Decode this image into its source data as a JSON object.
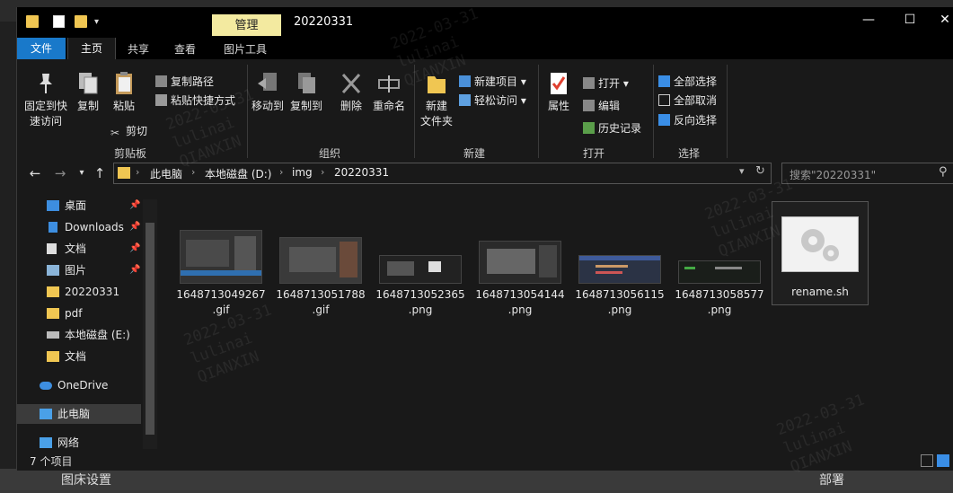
{
  "background": {
    "bottom_label": "图床设置",
    "bottom_right_label": "部署"
  },
  "titlebar": {
    "context_tab": "管理",
    "title": "20220331",
    "minimize": "—",
    "maximize": "☐",
    "close": "✕"
  },
  "ribbon_tabs": {
    "file": "文件",
    "home": "主页",
    "share": "共享",
    "view": "查看",
    "picture_tools": "图片工具"
  },
  "ribbon": {
    "clipboard": {
      "group": "剪贴板",
      "pin_quick_access_line1": "固定到快",
      "pin_quick_access_line2": "速访问",
      "copy": "复制",
      "paste": "粘贴",
      "copy_path": "复制路径",
      "paste_shortcut": "粘贴快捷方式",
      "cut": "剪切"
    },
    "organize": {
      "group": "组织",
      "move_to": "移动到",
      "copy_to": "复制到",
      "delete": "删除",
      "rename": "重命名"
    },
    "new": {
      "group": "新建",
      "new_folder_line1": "新建",
      "new_folder_line2": "文件夹",
      "new_item": "新建项目",
      "easy_access": "轻松访问"
    },
    "open": {
      "group": "打开",
      "properties": "属性",
      "open": "打开",
      "edit": "编辑",
      "history": "历史记录"
    },
    "select": {
      "group": "选择",
      "select_all": "全部选择",
      "select_none": "全部取消",
      "invert": "反向选择"
    }
  },
  "address": {
    "crumbs": [
      "此电脑",
      "本地磁盘 (D:)",
      "img",
      "20220331"
    ],
    "search_placeholder": "搜索\"20220331\""
  },
  "nav_pane": {
    "items": [
      {
        "label": "桌面",
        "pinned": true
      },
      {
        "label": "Downloads",
        "pinned": true
      },
      {
        "label": "文档",
        "pinned": true
      },
      {
        "label": "图片",
        "pinned": true
      },
      {
        "label": "20220331",
        "pinned": false
      },
      {
        "label": "pdf",
        "pinned": false
      },
      {
        "label": "本地磁盘 (E:)",
        "pinned": false
      },
      {
        "label": "文档",
        "pinned": false
      },
      {
        "label": "OneDrive",
        "pinned": false
      },
      {
        "label": "此电脑",
        "pinned": false
      },
      {
        "label": "网络",
        "pinned": false
      }
    ],
    "pin_glyph": "📌"
  },
  "files": [
    {
      "name_line1": "1648713049267",
      "name_line2": ".gif"
    },
    {
      "name_line1": "1648713051788",
      "name_line2": ".gif"
    },
    {
      "name_line1": "1648713052365",
      "name_line2": ".png"
    },
    {
      "name_line1": "1648713054144",
      "name_line2": ".png"
    },
    {
      "name_line1": "1648713056115",
      "name_line2": ".png"
    },
    {
      "name_line1": "1648713058577",
      "name_line2": ".png"
    },
    {
      "name_line1": "rename.sh",
      "name_line2": ""
    }
  ],
  "status": {
    "item_count": "7 个项目"
  },
  "watermark": {
    "date": "2022-03-31",
    "user": "lulinai",
    "org": "QIANXIN"
  },
  "colors": {
    "accent": "#1979ca",
    "folder": "#f0c652",
    "context_tab": "#f3eaa0"
  }
}
